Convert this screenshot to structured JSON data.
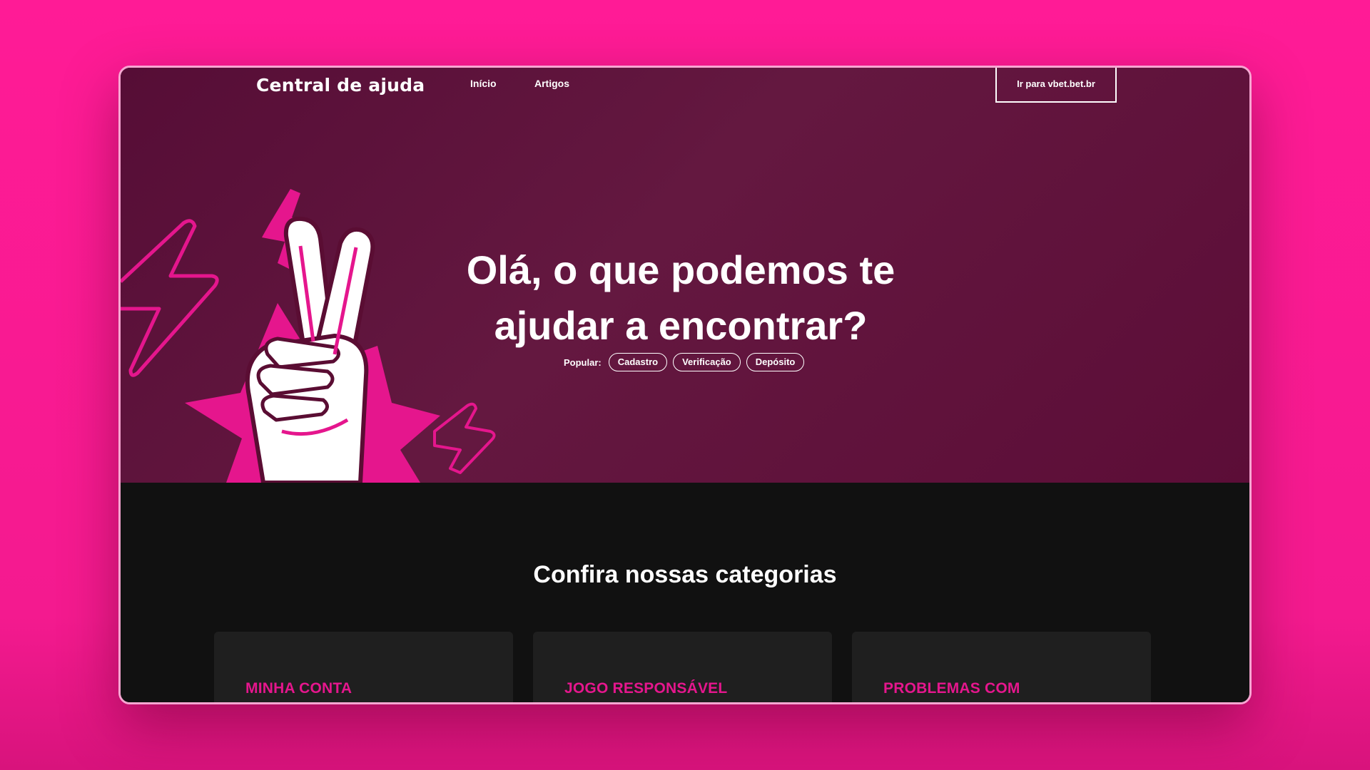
{
  "nav": {
    "brand": "Central de ajuda",
    "links": [
      {
        "label": "Início"
      },
      {
        "label": "Artigos"
      }
    ],
    "cta_label": "Ir para vbet.bet.br"
  },
  "hero": {
    "title_line1": "Olá, o que podemos te",
    "title_line2": "ajudar a encontrar?",
    "popular_label": "Popular:",
    "popular_tags": [
      "Cadastro",
      "Verificação",
      "Depósito"
    ]
  },
  "categories": {
    "title": "Confira nossas categorias",
    "cards": [
      {
        "label": "MINHA CONTA"
      },
      {
        "label": "JOGO RESPONSÁVEL"
      },
      {
        "label": "PROBLEMAS COM"
      }
    ]
  },
  "colors": {
    "page_background": "#ff1b96",
    "hero_background": "#5e1239",
    "accent": "#e5168d",
    "dark_section": "#111111",
    "card": "#1f1f1f"
  },
  "icons": {
    "hero_illustration": "peace-hand-icon",
    "decorations": [
      "lightning-bolt-icon",
      "star-burst-icon"
    ]
  }
}
